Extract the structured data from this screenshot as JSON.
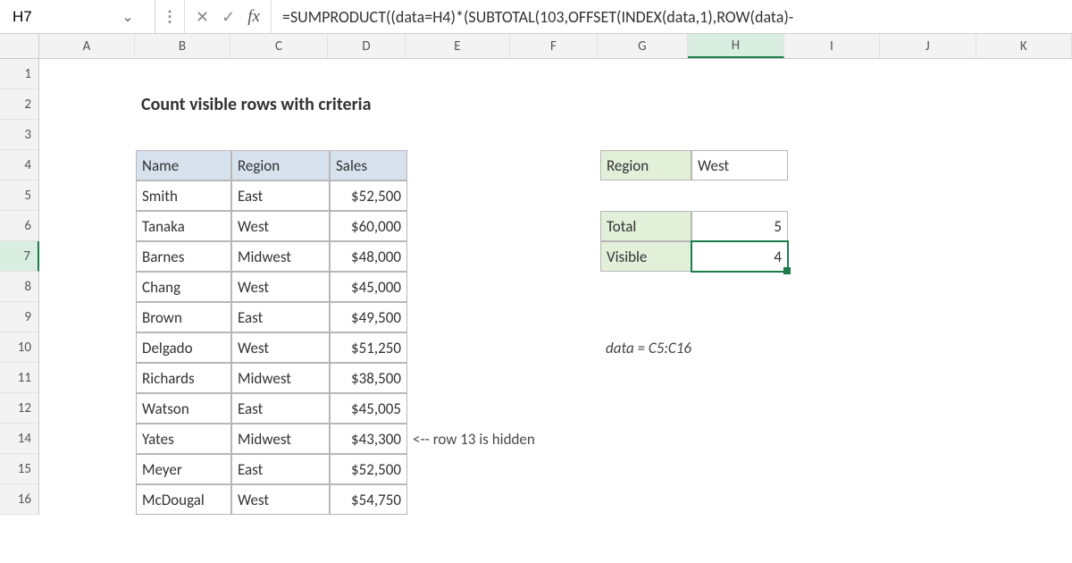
{
  "cellref": "H7",
  "formula": "=SUMPRODUCT((data=H4)*(SUBTOTAL(103,OFFSET(INDEX(data,1),ROW(data)-",
  "columns": [
    "A",
    "B",
    "C",
    "D",
    "E",
    "F",
    "G",
    "H",
    "I",
    "J",
    "K"
  ],
  "rows": [
    "1",
    "2",
    "3",
    "4",
    "5",
    "6",
    "7",
    "8",
    "9",
    "10",
    "11",
    "12",
    "14",
    "15",
    "16"
  ],
  "selected_row": "7",
  "selected_col": "H",
  "title": "Count visible rows with criteria",
  "tbl": {
    "headers": {
      "name": "Name",
      "region": "Region",
      "sales": "Sales"
    },
    "rows": [
      {
        "name": "Smith",
        "region": "East",
        "sales": "$52,500"
      },
      {
        "name": "Tanaka",
        "region": "West",
        "sales": "$60,000"
      },
      {
        "name": "Barnes",
        "region": "Midwest",
        "sales": "$48,000"
      },
      {
        "name": "Chang",
        "region": "West",
        "sales": "$45,000"
      },
      {
        "name": "Brown",
        "region": "East",
        "sales": "$49,500"
      },
      {
        "name": "Delgado",
        "region": "West",
        "sales": "$51,250"
      },
      {
        "name": "Richards",
        "region": "Midwest",
        "sales": "$38,500"
      },
      {
        "name": "Watson",
        "region": "East",
        "sales": "$45,005"
      },
      {
        "name": "Yates",
        "region": "Midwest",
        "sales": "$43,300"
      },
      {
        "name": "Meyer",
        "region": "East",
        "sales": "$52,500"
      },
      {
        "name": "McDougal",
        "region": "West",
        "sales": "$54,750"
      }
    ]
  },
  "summary": {
    "region_label": "Region",
    "region_value": "West",
    "total_label": "Total",
    "total_value": "5",
    "visible_label": "Visible",
    "visible_value": "4"
  },
  "hidden_note": "<-- row 13 is hidden",
  "data_def": "data = C5:C16"
}
